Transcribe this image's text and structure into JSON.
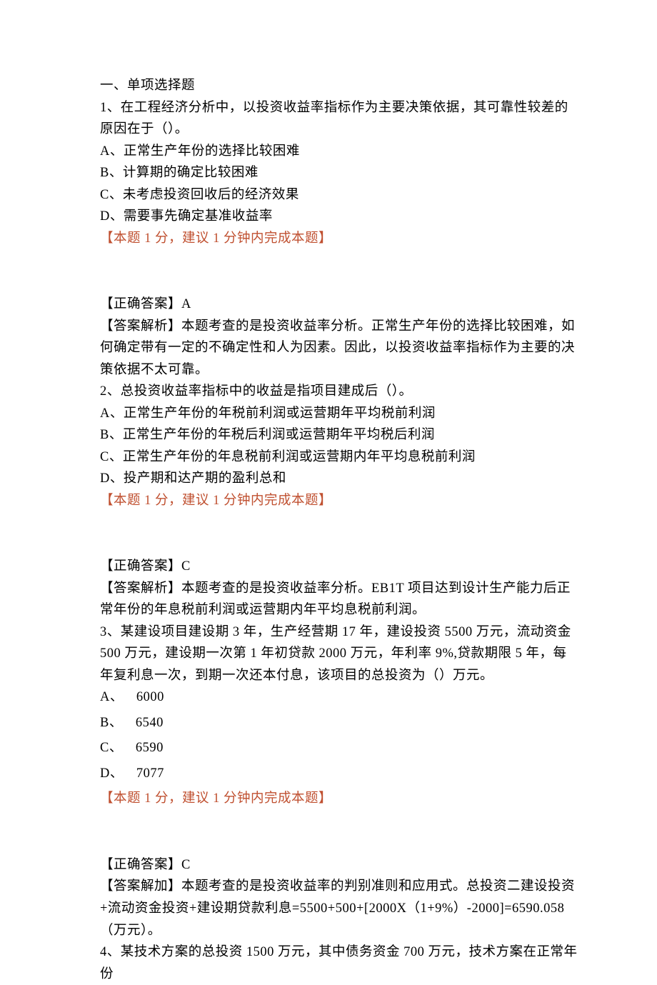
{
  "section_title": "一、单项选择题",
  "q1": {
    "stem": "1、在工程经济分析中，以投资收益率指标作为主要决策依据，其可靠性较差的原因在于（）。",
    "optA": "A、正常生产年份的选择比较困难",
    "optB": "B、计算期的确定比较困难",
    "optC": "C、未考虑投资回收后的经济效果",
    "optD": "D、需要事先确定基准收益率",
    "hint": "【本题 1 分，建议 1 分钟内完成本题】",
    "answer": "【正确答案】A",
    "explain": "【答案解析】本题考查的是投资收益率分析。正常生产年份的选择比较困难，如何确定带有一定的不确定性和人为因素。因此，以投资收益率指标作为主要的决策依据不太可靠。"
  },
  "q2": {
    "stem": "2、总投资收益率指标中的收益是指项目建成后（）。",
    "optA": "A、正常生产年份的年税前利润或运营期年平均税前利润",
    "optB": "B、正常生产年份的年税后利润或运营期年平均税后利润",
    "optC": "C、正常生产年份的年息税前利润或运营期内年平均息税前利润",
    "optD": "D、投产期和达产期的盈利总和",
    "hint": "【本题 1 分，建议 1 分钟内完成本题】",
    "answer": "【正确答案】C",
    "explain": "【答案解析】本题考查的是投资收益率分析。EB1T 项目达到设计生产能力后正常年份的年息税前利润或运营期内年平均息税前利润。"
  },
  "q3": {
    "stem": "3、某建设项目建设期 3 年，生产经营期 17 年，建设投资 5500 万元，流动资金 500 万元，建设期一次第 1 年初贷款 2000 万元，年利率 9%,贷款期限 5 年，每年复利息一次，到期一次还本付息，该项目的总投资为（）万元。",
    "optA_label": "A、",
    "optA_value": "6000",
    "optB_label": "B、",
    "optB_value": "6540",
    "optC_label": "C、",
    "optC_value": "6590",
    "optD_label": "D、",
    "optD_value": "7077",
    "hint": "【本题 1 分，建议 1 分钟内完成本题】",
    "answer": "【正确答案】C",
    "explain": "【答案解加】本题考查的是投资收益率的判别准则和应用式。总投资二建设投资+流动资金投资+建设期贷款利息=5500+500+[2000X（1+9%）-2000]=6590.058（万元）。"
  },
  "q4": {
    "stem": "4、某技术方案的总投资 1500 万元，其中债务资金 700 万元，技术方案在正常年份"
  }
}
